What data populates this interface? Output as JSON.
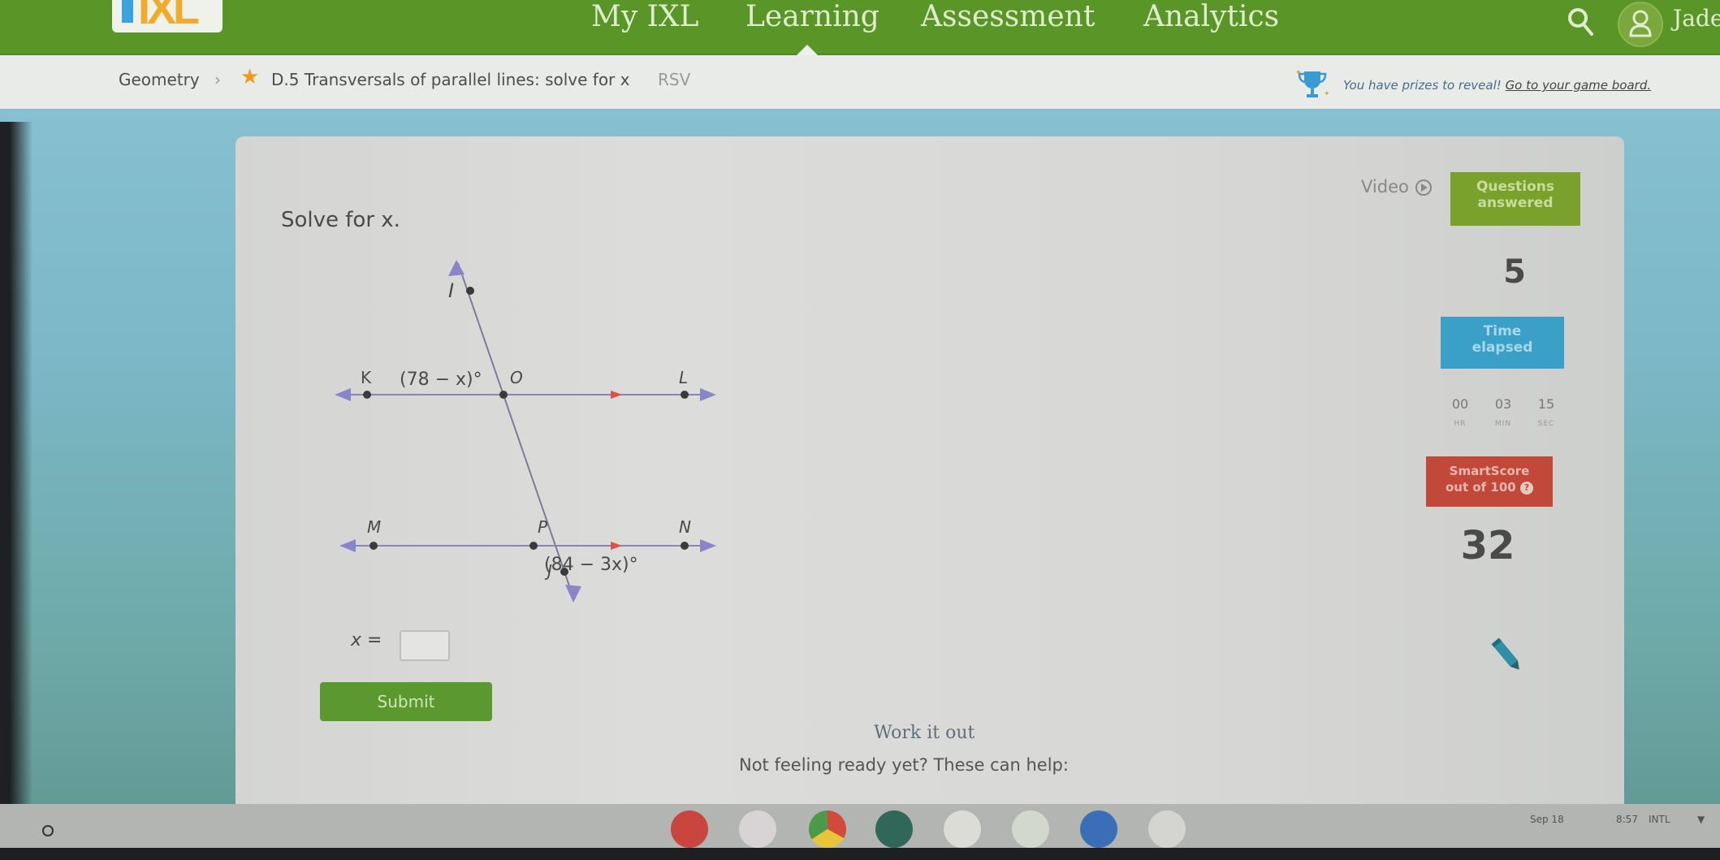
{
  "nav": {
    "logo": "IXL",
    "items": [
      {
        "label": "My IXL"
      },
      {
        "label": "Learning"
      },
      {
        "label": "Assessment"
      },
      {
        "label": "Analytics"
      }
    ],
    "active": "Learning",
    "user_name": "Jaden",
    "icons": {
      "search": "search-icon",
      "avatar": "user-icon"
    }
  },
  "breadcrumb": {
    "subject": "Geometry",
    "separator": "›",
    "star": "★",
    "skill": "D.5 Transversals of parallel lines: solve for x",
    "code": "RSV",
    "prize_text": "You have prizes to reveal!",
    "prize_link": "Go to your game board."
  },
  "question": {
    "prompt": "Solve for x.",
    "diagram": {
      "points": [
        "I",
        "K",
        "O",
        "L",
        "M",
        "P",
        "N",
        "J"
      ],
      "angle_top": "(78 − x)°",
      "angle_bottom": "(84 − 3x)°"
    },
    "answer_label": "x =",
    "answer_value": "",
    "submit_label": "Submit"
  },
  "help": {
    "work_it_out": "Work it out",
    "not_ready": "Not feeling ready yet? These can help:"
  },
  "stats": {
    "video_label": "Video",
    "questions_answered_label_1": "Questions",
    "questions_answered_label_2": "answered",
    "questions_answered": "5",
    "time_elapsed_label_1": "Time",
    "time_elapsed_label_2": "elapsed",
    "timer": [
      {
        "value": "00",
        "unit": "HR"
      },
      {
        "value": "03",
        "unit": "MIN"
      },
      {
        "value": "15",
        "unit": "SEC"
      }
    ],
    "smartscore_label_1": "SmartScore",
    "smartscore_label_2": "out of 100",
    "smartscore": "32"
  },
  "shelf": {
    "apps": [
      "app-red",
      "app-photo",
      "chrome",
      "app-classroom",
      "app-dots",
      "app-key",
      "app-camera",
      "app-people"
    ],
    "date": "Sep 18",
    "time": "8:57",
    "locale": "INTL"
  },
  "colors": {
    "nav_green": "#5a9528",
    "questions_green": "#7aa12c",
    "time_blue": "#3aa0c8",
    "smartscore_red": "#c2493a",
    "submit_green": "#5c9830"
  }
}
